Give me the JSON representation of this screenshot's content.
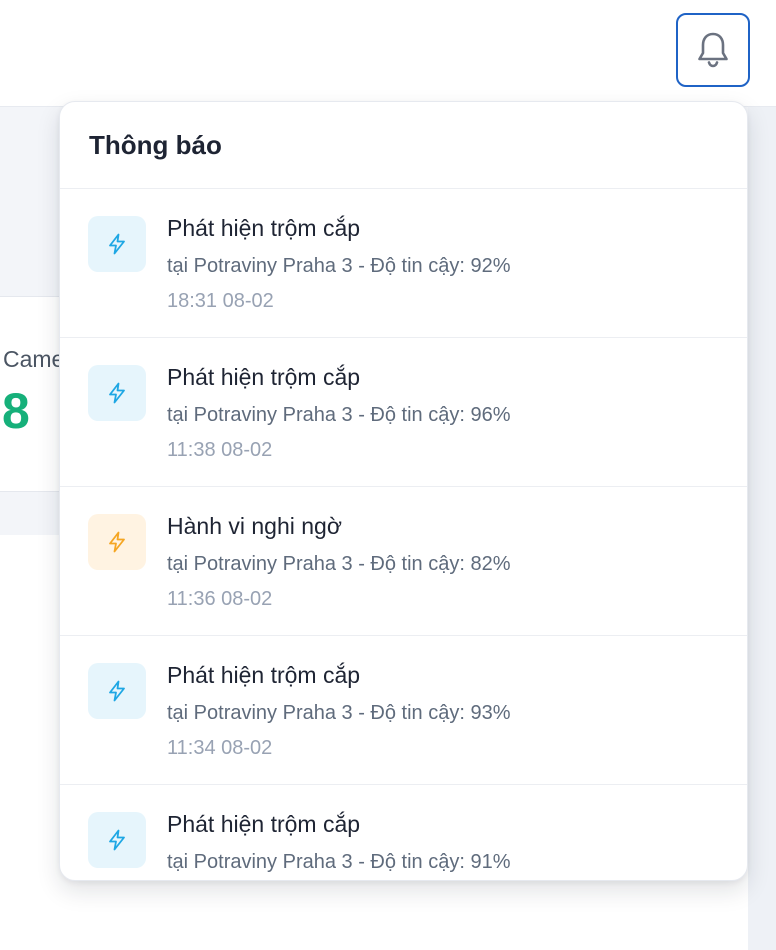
{
  "stat": {
    "label": "Came",
    "value": "8"
  },
  "notifications": {
    "title": "Thông báo",
    "items": [
      {
        "title": "Phát hiện trộm cắp",
        "subtitle": "tại Potraviny Praha 3 - Độ tin cậy: 92%",
        "time": "18:31 08-02",
        "type": "theft",
        "color": "#1ea7e4"
      },
      {
        "title": "Phát hiện trộm cắp",
        "subtitle": "tại Potraviny Praha 3 - Độ tin cậy: 96%",
        "time": "11:38 08-02",
        "type": "theft",
        "color": "#1ea7e4"
      },
      {
        "title": "Hành vi nghi ngờ",
        "subtitle": "tại Potraviny Praha 3 - Độ tin cậy: 82%",
        "time": "11:36 08-02",
        "type": "suspicious",
        "color": "#f5a623"
      },
      {
        "title": "Phát hiện trộm cắp",
        "subtitle": "tại Potraviny Praha 3 - Độ tin cậy: 93%",
        "time": "11:34 08-02",
        "type": "theft",
        "color": "#1ea7e4"
      },
      {
        "title": "Phát hiện trộm cắp",
        "subtitle": "tại Potraviny Praha 3 - Độ tin cậy: 91%",
        "time": "",
        "type": "theft",
        "color": "#1ea7e4"
      }
    ]
  },
  "icons": {
    "bell": "bell-icon",
    "item": "lightning-icon"
  },
  "colors": {
    "accent": "#1f63c6",
    "success": "#16b07a",
    "theft_bg": "#e6f5fc",
    "suspicious_bg": "#fff3e2"
  }
}
